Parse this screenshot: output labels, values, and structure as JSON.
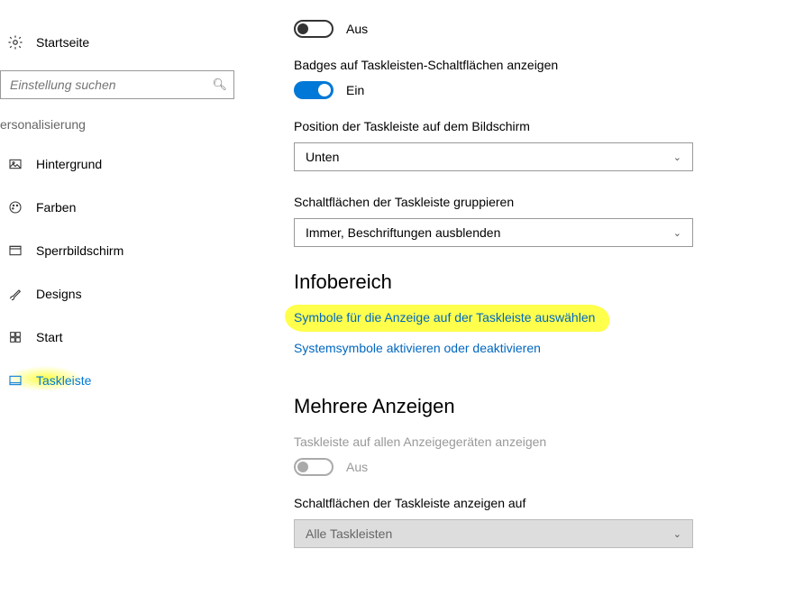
{
  "sidebar": {
    "home_label": "Startseite",
    "search_placeholder": "Einstellung suchen",
    "category_label": "ersonalisierung",
    "items": [
      {
        "label": "Hintergrund"
      },
      {
        "label": "Farben"
      },
      {
        "label": "Sperrbildschirm"
      },
      {
        "label": "Designs"
      },
      {
        "label": "Start"
      },
      {
        "label": "Taskleiste"
      }
    ]
  },
  "main": {
    "toggle1_state": "Aus",
    "badges_label": "Badges auf Taskleisten-Schaltflächen anzeigen",
    "toggle2_state": "Ein",
    "position_label": "Position der Taskleiste auf dem Bildschirm",
    "position_value": "Unten",
    "group_label": "Schaltflächen der Taskleiste gruppieren",
    "group_value": "Immer, Beschriftungen ausblenden",
    "info_heading": "Infobereich",
    "link_select_icons": "Symbole für die Anzeige auf der Taskleiste auswählen",
    "link_system_icons": "Systemsymbole aktivieren oder deaktivieren",
    "multi_heading": "Mehrere Anzeigen",
    "multi_label": "Taskleiste auf allen Anzeigegeräten anzeigen",
    "toggle3_state": "Aus",
    "showon_label": "Schaltflächen der Taskleiste anzeigen auf",
    "showon_value": "Alle Taskleisten"
  }
}
